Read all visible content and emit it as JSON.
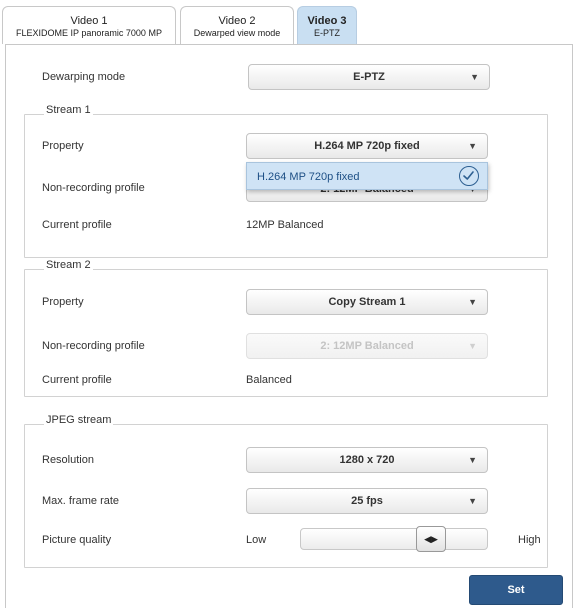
{
  "tabs": [
    {
      "title": "Video 1",
      "subtitle": "FLEXIDOME IP panoramic 7000 MP"
    },
    {
      "title": "Video 2",
      "subtitle": "Dewarped view mode"
    },
    {
      "title": "Video 3",
      "subtitle": "E-PTZ"
    }
  ],
  "dewarping": {
    "label": "Dewarping mode",
    "value": "E-PTZ"
  },
  "stream1": {
    "title": "Stream 1",
    "property_label": "Property",
    "property_value": "H.264 MP 720p fixed",
    "dropdown_option": "H.264 MP 720p fixed",
    "nonrec_label": "Non-recording profile",
    "nonrec_value_partial": "2: 12MP Balanced",
    "current_label": "Current profile",
    "current_value": "12MP Balanced"
  },
  "stream2": {
    "title": "Stream 2",
    "property_label": "Property",
    "property_value": "Copy Stream 1",
    "nonrec_label": "Non-recording profile",
    "nonrec_value": "2: 12MP Balanced",
    "current_label": "Current profile",
    "current_value": "Balanced"
  },
  "jpeg": {
    "title": "JPEG stream",
    "resolution_label": "Resolution",
    "resolution_value": "1280 x 720",
    "framerate_label": "Max. frame rate",
    "framerate_value": "25 fps",
    "quality_label": "Picture quality",
    "quality_low": "Low",
    "quality_high": "High",
    "quality_level": 0.67
  },
  "set_label": "Set",
  "icons": {
    "arrow": "▼",
    "slider": "◀▶"
  }
}
